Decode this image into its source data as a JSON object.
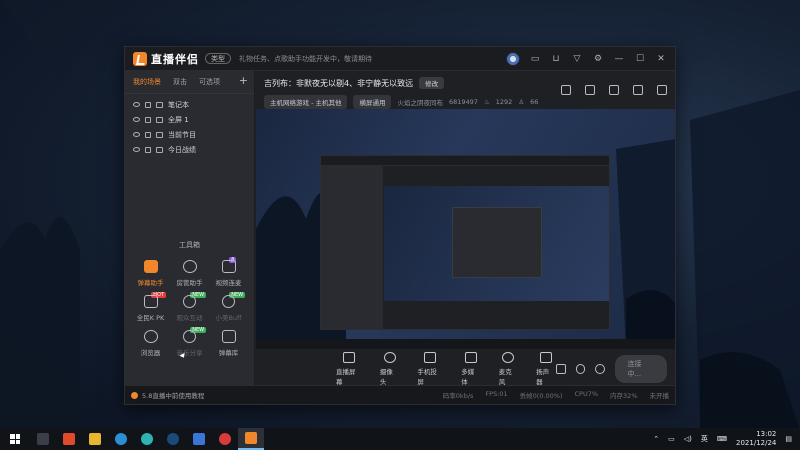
{
  "titlebar": {
    "app_name": "直播伴侣",
    "version": "类型",
    "ticker": "礼物任务、点歌助手功能开发中，敬请期待"
  },
  "scenes": {
    "tabs": [
      "我的场景",
      "双击",
      "可选项"
    ],
    "add": "+",
    "sources": [
      {
        "label": "笔记本"
      },
      {
        "label": "全屏 1"
      },
      {
        "label": "当前节目"
      },
      {
        "label": "今日战绩"
      }
    ]
  },
  "tools": {
    "title": "工具箱",
    "items": [
      {
        "label": "弹幕助手",
        "active": true,
        "icon": "danmaku-icon"
      },
      {
        "label": "房管助手",
        "icon": "admin-icon"
      },
      {
        "label": "视频连麦",
        "tag": "beta",
        "icon": "video-link-icon"
      },
      {
        "label": "全民K PK",
        "tag": "hot",
        "icon": "pk-icon"
      },
      {
        "label": "观众互动",
        "tag": "new",
        "dim": true,
        "icon": "download-icon"
      },
      {
        "label": "小美Buff",
        "tag": "new",
        "dim": true,
        "icon": "download-icon"
      },
      {
        "label": "浏览器",
        "icon": "browser-icon"
      },
      {
        "label": "音乐分享",
        "tag": "new",
        "dim": true,
        "icon": "download-icon"
      },
      {
        "label": "弹幕库",
        "icon": "danmaku-lib-icon"
      }
    ]
  },
  "room": {
    "title": "吉列布：非默夜无以剔4、非宁静无以致远",
    "modify": "修改",
    "category": "主机网络游戏 - 主机其他",
    "status_pill": "横屏通用",
    "meta_user": "火焰之阴夜同布",
    "meta_id": "6819497",
    "fire": "1292",
    "viewers": "66"
  },
  "controls": {
    "items": [
      {
        "label": "直播屏幕",
        "icon": "screen-icon"
      },
      {
        "label": "摄像头",
        "icon": "camera-icon"
      },
      {
        "label": "手机投屏",
        "icon": "phone-cast-icon"
      },
      {
        "label": "多媒体",
        "icon": "media-icon"
      },
      {
        "label": "麦克风",
        "icon": "mic-icon"
      },
      {
        "label": "扬声器",
        "icon": "speaker-icon"
      }
    ],
    "start_label": "连接中..."
  },
  "status": {
    "left": "5.8直播中前使用教程",
    "items": [
      "码率0kb/s",
      "FPS:01",
      "丢帧0(0.00%)",
      "CPU7%",
      "内存32%",
      "未开播"
    ]
  },
  "taskbar": {
    "time": "13:02",
    "date": "2021/12/24",
    "ime": "英",
    "apps": [
      {
        "name": "task-view",
        "color": "#3a3f47"
      },
      {
        "name": "app-red",
        "color": "#e04a2c"
      },
      {
        "name": "file-explorer",
        "color": "#e8b530"
      },
      {
        "name": "edge",
        "color": "#2a8fd6"
      },
      {
        "name": "app-teal",
        "color": "#2fb3b3"
      },
      {
        "name": "steam",
        "color": "#1b4a78"
      },
      {
        "name": "app-blue",
        "color": "#3a76d8"
      },
      {
        "name": "netease-music",
        "color": "#d83b3b"
      },
      {
        "name": "live-companion",
        "color": "#f0872c",
        "active": true
      }
    ]
  },
  "colors": {
    "accent": "#f0872c"
  }
}
